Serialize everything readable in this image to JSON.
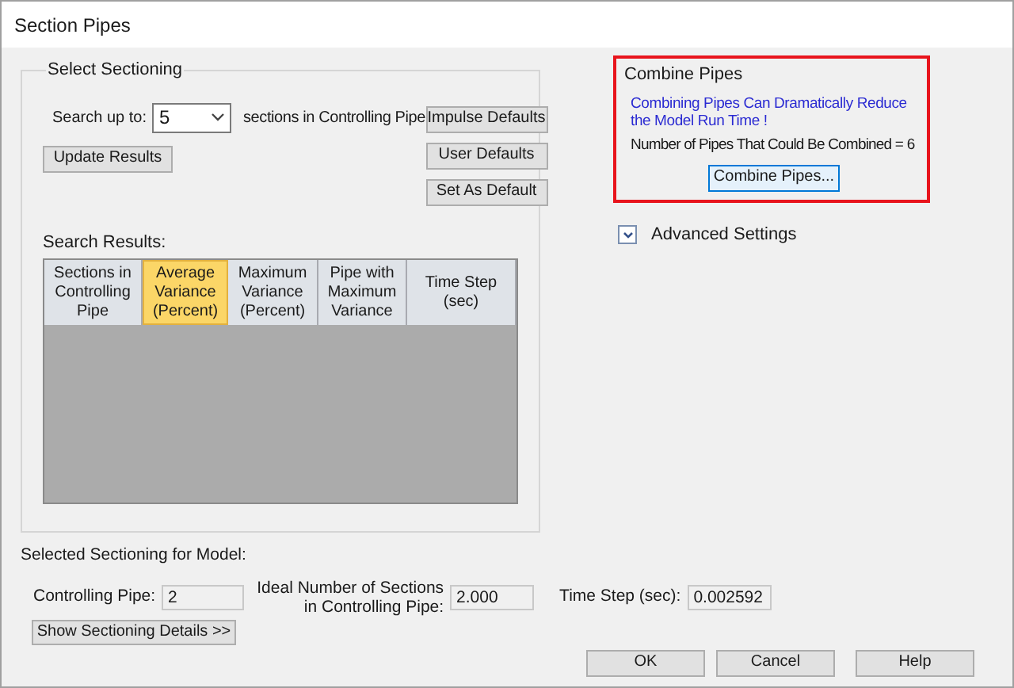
{
  "window": {
    "title": "Section Pipes"
  },
  "select_sectioning": {
    "title": "Select Sectioning",
    "search_label": "Search up to:",
    "search_value": "5",
    "search_suffix": "sections in Controlling Pipe",
    "update_button": "Update Results",
    "default_buttons": [
      "Impulse Defaults",
      "User Defaults",
      "Set As Default"
    ],
    "results_label": "Search Results:",
    "columns": [
      {
        "label": "Sections in Controlling Pipe",
        "selected": false
      },
      {
        "label": "Average Variance (Percent)",
        "selected": true
      },
      {
        "label": "Maximum Variance (Percent)",
        "selected": false
      },
      {
        "label": "Pipe with Maximum Variance",
        "selected": false
      },
      {
        "label": "Time Step (sec)",
        "selected": false
      }
    ]
  },
  "combine_pipes": {
    "title": "Combine Pipes",
    "message": "Combining Pipes Can Dramatically Reduce the Model Run Time !",
    "count": "Number of Pipes That Could Be Combined = 6",
    "button": "Combine Pipes...",
    "highlighted": true
  },
  "advanced_settings": {
    "label": "Advanced Settings",
    "expanded": false
  },
  "selected_sectioning": {
    "title": "Selected Sectioning for Model:",
    "fields": [
      {
        "label": "Controlling Pipe:",
        "value": "2"
      },
      {
        "label": "Ideal Number of Sections in Controlling Pipe:",
        "value": "2.000"
      },
      {
        "label": "Time Step (sec):",
        "value": "0.002592"
      }
    ],
    "details_button": "Show Sectioning Details >>"
  },
  "buttons": [
    "OK",
    "Cancel",
    "Help"
  ]
}
